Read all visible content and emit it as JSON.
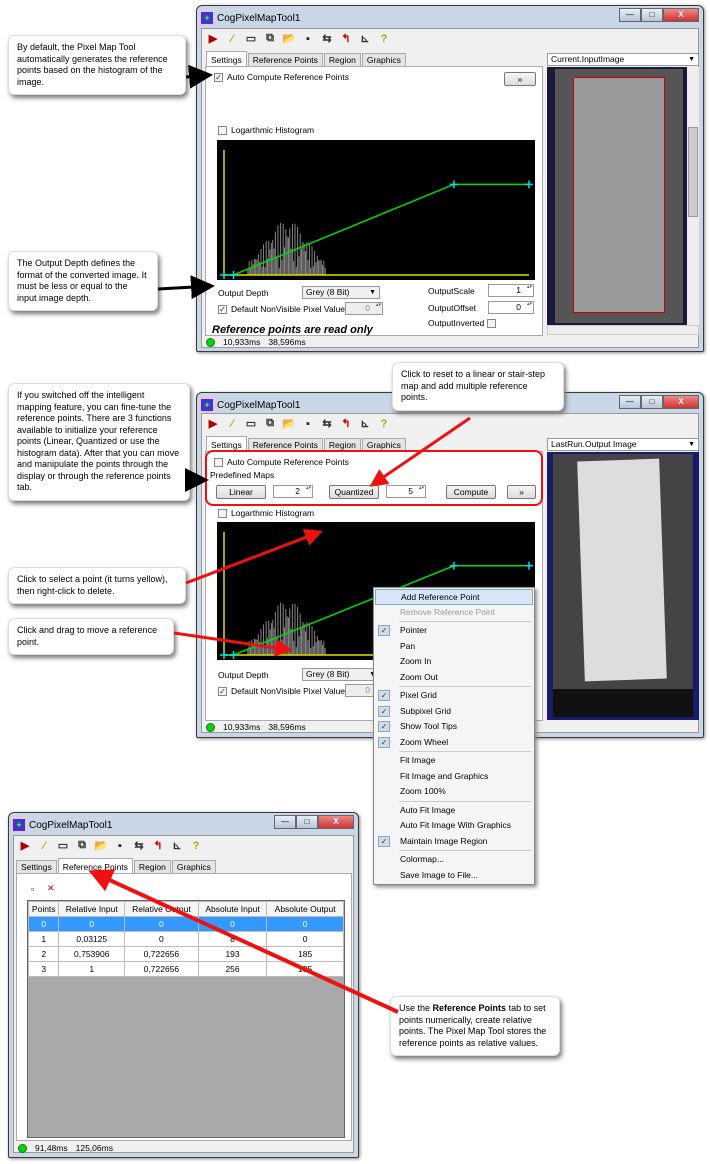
{
  "window_title": "CogPixelMapTool1",
  "window_buttons": {
    "minimize": "—",
    "maximize": "□",
    "close": "X"
  },
  "tabs": [
    "Settings",
    "Reference Points",
    "Region",
    "Graphics"
  ],
  "toolbar_icons": [
    "run-icon",
    "edit-icon",
    "display-icon",
    "copy-icon",
    "open-icon",
    "save-icon",
    "reset-icon",
    "load-icon",
    "measure-icon",
    "help-icon"
  ],
  "colors": {
    "histogram_line": "#00dd00",
    "axis": "#e0e000",
    "point": "#00e0e0",
    "highlight": "#ee1111",
    "selected_row": "#3399ff"
  },
  "panel1": {
    "auto_compute_label": "Auto Compute Reference Points",
    "auto_compute_checked": true,
    "expand_button": "»",
    "log_histogram_label": "Logarthmic Histogram",
    "output_depth_label": "Output Depth",
    "output_depth_value": "Grey (8 Bit)",
    "default_nonvisible_label": "Default NonVisible Pixel Value",
    "default_nonvisible_value": "0",
    "output_scale_label": "OutputScale",
    "output_scale_value": "1",
    "output_offset_label": "OutputOffset",
    "output_offset_value": "0",
    "output_inverted_label": "OutputInverted",
    "read_only_text": "Reference points are read only",
    "image_dropdown": "Current.InputImage",
    "status": [
      "10,933ms",
      "38,596ms"
    ]
  },
  "panel2": {
    "auto_compute_label": "Auto Compute Reference Points",
    "auto_compute_checked": false,
    "predefined_maps_label": "Predefined Maps",
    "linear_button": "Linear",
    "linear_value": "2",
    "quantized_button": "Quantized",
    "quantized_value": "5",
    "compute_button": "Compute",
    "expand_button": "»",
    "log_histogram_label": "Logarthmic Histogram",
    "output_depth_label": "Output Depth",
    "output_depth_value": "Grey (8 Bit)",
    "default_nonvisible_label": "Default NonVisible Pixel Value",
    "default_nonvisible_value": "0",
    "image_dropdown": "LastRun.Output Image",
    "status": [
      "10,933ms",
      "38,596ms"
    ]
  },
  "context_menu": [
    {
      "label": "Add Reference Point",
      "highlighted": true
    },
    {
      "label": "Remove Reference Point",
      "disabled": true
    },
    {
      "sep": true
    },
    {
      "label": "Pointer",
      "checked": true
    },
    {
      "label": "Pan"
    },
    {
      "label": "Zoom In"
    },
    {
      "label": "Zoom Out"
    },
    {
      "sep": true
    },
    {
      "label": "Pixel Grid",
      "checked": true
    },
    {
      "label": "Subpixel Grid",
      "checked": true
    },
    {
      "label": "Show Tool Tips",
      "checked": true
    },
    {
      "label": "Zoom Wheel",
      "checked": true
    },
    {
      "sep": true
    },
    {
      "label": "Fit Image"
    },
    {
      "label": "Fit Image and Graphics"
    },
    {
      "label": "Zoom 100%"
    },
    {
      "sep": true
    },
    {
      "label": "Auto Fit Image"
    },
    {
      "label": "Auto Fit Image With Graphics"
    },
    {
      "label": "Maintain Image Region",
      "checked": true
    },
    {
      "sep": true
    },
    {
      "label": "Colormap..."
    },
    {
      "label": "Save Image to File..."
    }
  ],
  "panel3": {
    "columns": [
      "Points",
      "Relative Input",
      "Relative Output",
      "Absolute Input",
      "Absolute Output"
    ],
    "rows": [
      [
        "0",
        "0",
        "0",
        "0",
        "0"
      ],
      [
        "1",
        "0,03125",
        "0",
        "8",
        "0"
      ],
      [
        "2",
        "0,753906",
        "0,722656",
        "193",
        "185"
      ],
      [
        "3",
        "1",
        "0,722656",
        "256",
        "185"
      ]
    ],
    "selected_row": 0,
    "status": [
      "91,48ms",
      "125,06ms"
    ]
  },
  "callouts": {
    "c1": "By default, the Pixel Map Tool automatically generates the reference points based on the histogram of the image.",
    "c2": "The Output Depth defines the format of the converted image. It must be less or equal to the input image depth.",
    "c3": "Click to reset to a linear or stair-step map and add multiple reference points.",
    "c4": "If you switched off the intelligent mapping feature, you can fine-tune the reference points. There are 3 functions available to initialize your reference points (Linear, Quantized or use the histogram data). After that you can move and manipulate the points through the display or through the reference points tab.",
    "c5": "Click to select a point (it turns yellow), then right-click to delete.",
    "c6": "Click and drag to move a reference point.",
    "c7_pre": "Use the ",
    "c7_bold": "Reference Points",
    "c7_post": " tab to set points numerically, create relative points. The Pixel Map Tool stores the reference points as relative values."
  },
  "histogram_points": [
    [
      0,
      0
    ],
    [
      8,
      0
    ],
    [
      193,
      185
    ],
    [
      256,
      185
    ]
  ]
}
